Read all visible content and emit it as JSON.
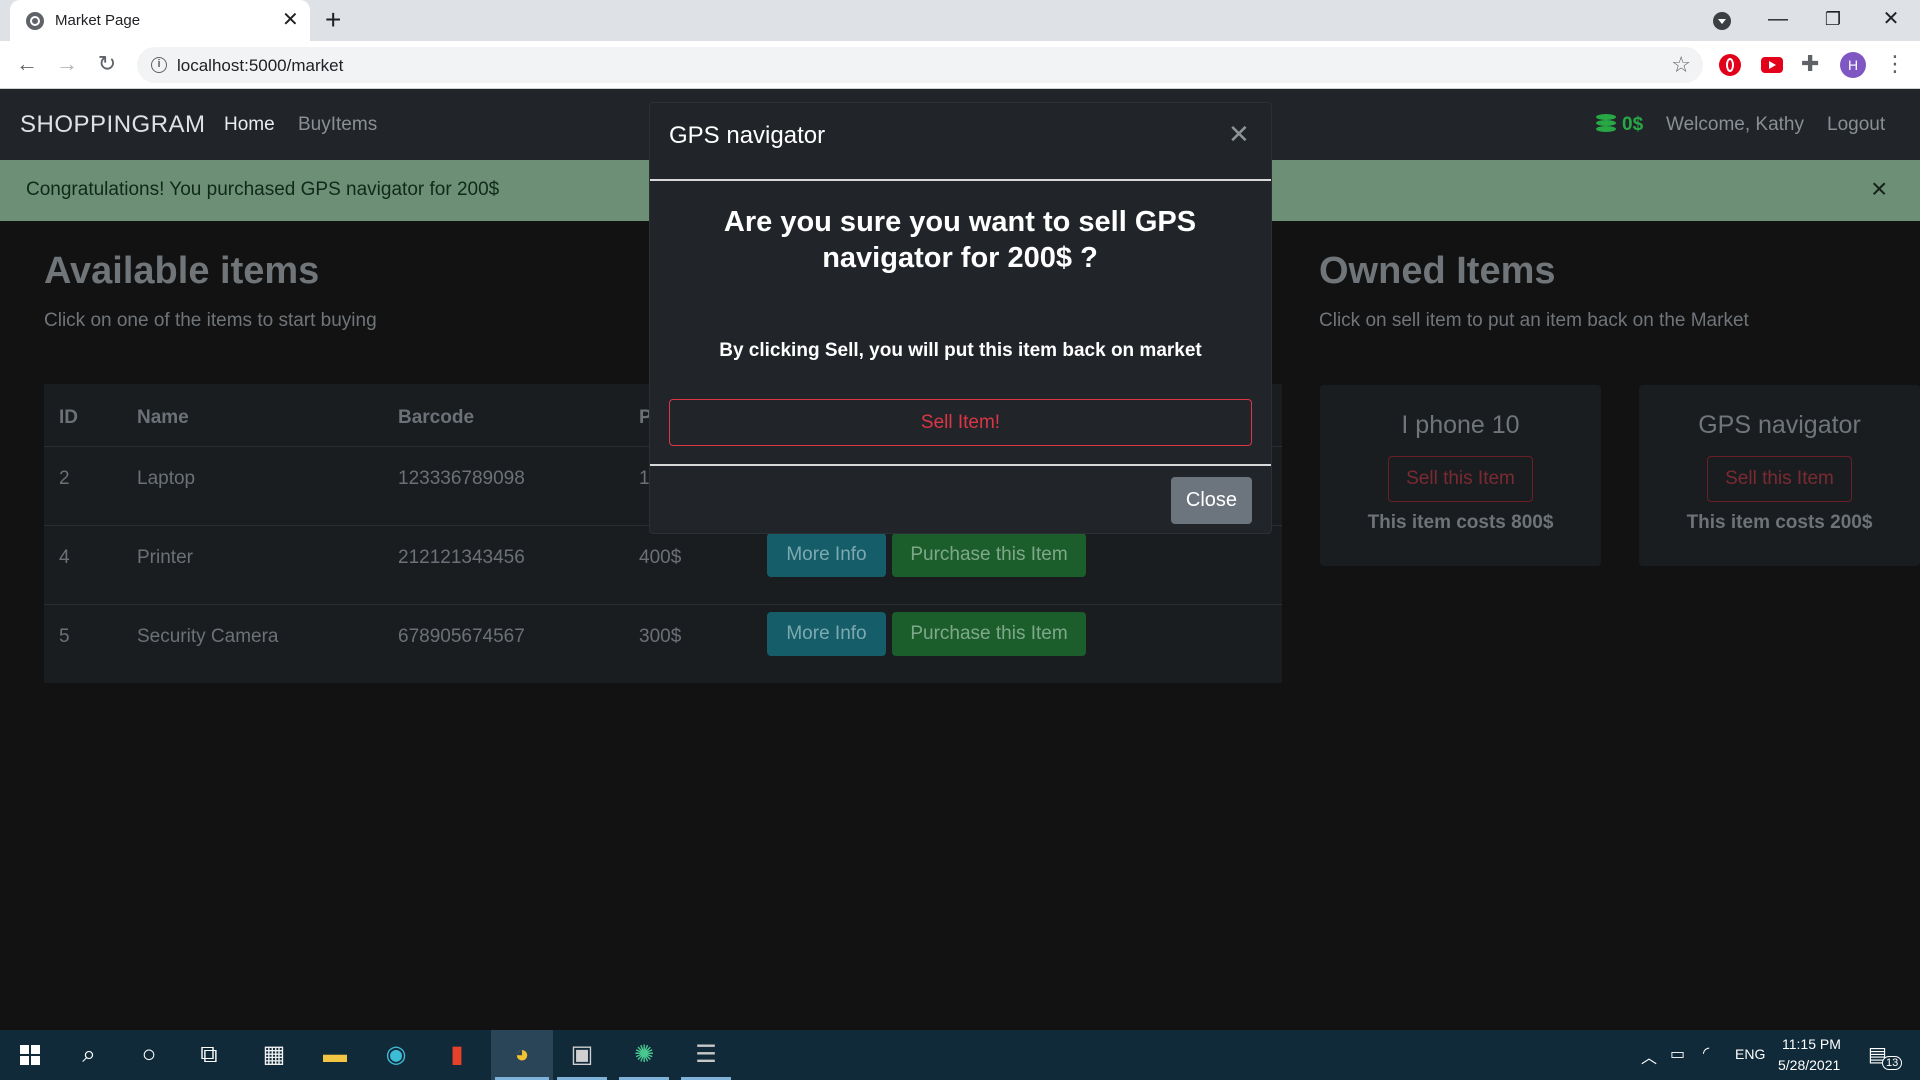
{
  "browser": {
    "tab_title": "Market Page",
    "url": "localhost:5000/market"
  },
  "site": {
    "brand": "SHOPPINGRAM",
    "nav": {
      "home": "Home",
      "buy": "BuyItems"
    },
    "budget": "0$",
    "welcome": "Welcome, Kathy",
    "logout": "Logout"
  },
  "alert": {
    "message": "Congratulations! You purchased GPS navigator for 200$",
    "close": "×"
  },
  "available": {
    "title": "Available items",
    "subtitle": "Click on one of the items to start buying",
    "headers": [
      "ID",
      "Name",
      "Barcode",
      "P"
    ],
    "rows": [
      {
        "id": "2",
        "name": "Laptop",
        "barcode": "123336789098",
        "price": "1"
      },
      {
        "id": "4",
        "name": "Printer",
        "barcode": "212121343456",
        "price": "400$"
      },
      {
        "id": "5",
        "name": "Security Camera",
        "barcode": "678905674567",
        "price": "300$"
      }
    ],
    "more_info_label": "More Info",
    "purchase_label": "Purchase this Item"
  },
  "owned": {
    "title": "Owned Items",
    "subtitle": "Click on sell item to put an item back on the Market",
    "items": [
      {
        "name": "I phone 10",
        "button": "Sell this Item",
        "cost": "This item costs 800$"
      },
      {
        "name": "GPS navigator",
        "button": "Sell this Item",
        "cost": "This item costs 200$"
      }
    ]
  },
  "modal": {
    "title": "GPS navigator",
    "question": "Are you sure you want to sell GPS navigator for 200$ ?",
    "note": "By clicking Sell, you will put this item back on market",
    "sell_label": "Sell Item!",
    "close_label": "Close"
  },
  "taskbar": {
    "language": "ENG",
    "time": "11:15 PM",
    "date": "5/28/2021",
    "notifications": "13"
  }
}
